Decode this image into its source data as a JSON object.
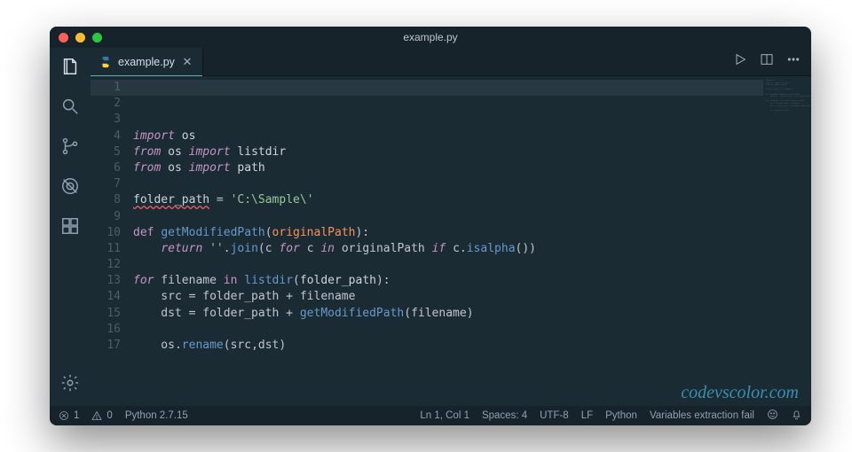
{
  "window": {
    "title": "example.py"
  },
  "tabs": {
    "items": [
      {
        "label": "example.py",
        "icon": "python"
      }
    ]
  },
  "editor": {
    "line_numbers": [
      "1",
      "2",
      "3",
      "4",
      "5",
      "6",
      "7",
      "8",
      "9",
      "10",
      "11",
      "12",
      "13",
      "14",
      "15",
      "16",
      "17"
    ],
    "code_tokens": [
      [
        [
          "kw",
          "import"
        ],
        [
          "pun",
          " "
        ],
        [
          "id",
          "os"
        ]
      ],
      [
        [
          "kw",
          "from"
        ],
        [
          "pun",
          " "
        ],
        [
          "id",
          "os"
        ],
        [
          "pun",
          " "
        ],
        [
          "kw",
          "import"
        ],
        [
          "pun",
          " "
        ],
        [
          "id",
          "listdir"
        ]
      ],
      [
        [
          "kw",
          "from"
        ],
        [
          "pun",
          " "
        ],
        [
          "id",
          "os"
        ],
        [
          "pun",
          " "
        ],
        [
          "kw",
          "import"
        ],
        [
          "pun",
          " "
        ],
        [
          "id",
          "path"
        ]
      ],
      [],
      [
        [
          "id sqr",
          "folder_path"
        ],
        [
          "pun",
          " = "
        ],
        [
          "str",
          "'C:\\Sample\\'"
        ]
      ],
      [],
      [
        [
          "kwni",
          "def"
        ],
        [
          "pun",
          " "
        ],
        [
          "fn",
          "getModifiedPath"
        ],
        [
          "pun",
          "("
        ],
        [
          "par",
          "originalPath"
        ],
        [
          "pun",
          "):"
        ]
      ],
      [
        [
          "pun",
          "    "
        ],
        [
          "kw",
          "return"
        ],
        [
          "pun",
          " "
        ],
        [
          "str",
          "''"
        ],
        [
          "pun",
          "."
        ],
        [
          "fn",
          "join"
        ],
        [
          "pun",
          "(c "
        ],
        [
          "kw",
          "for"
        ],
        [
          "pun",
          " c "
        ],
        [
          "kw",
          "in"
        ],
        [
          "pun",
          " originalPath "
        ],
        [
          "kw",
          "if"
        ],
        [
          "pun",
          " c."
        ],
        [
          "fn",
          "isalpha"
        ],
        [
          "pun",
          "())"
        ]
      ],
      [],
      [
        [
          "kw",
          "for"
        ],
        [
          "pun",
          " filename "
        ],
        [
          "kwni",
          "in"
        ],
        [
          "pun",
          " "
        ],
        [
          "fn",
          "listdir"
        ],
        [
          "pun",
          "("
        ],
        [
          "id",
          "folder_path"
        ],
        [
          "pun",
          "):"
        ]
      ],
      [
        [
          "pun",
          "    src = folder_path + filename"
        ]
      ],
      [
        [
          "pun",
          "    dst = folder_path + "
        ],
        [
          "fn",
          "getModifiedPath"
        ],
        [
          "pun",
          "(filename)"
        ]
      ],
      [],
      [
        [
          "pun",
          "    os."
        ],
        [
          "fn",
          "rename"
        ],
        [
          "pun",
          "(src,dst)"
        ]
      ],
      [],
      [],
      []
    ]
  },
  "status": {
    "errors": "1",
    "warnings": "0",
    "interpreter": "Python 2.7.15",
    "cursor": "Ln 1, Col 1",
    "spaces": "Spaces: 4",
    "encoding": "UTF-8",
    "eol": "LF",
    "language": "Python",
    "extra": "Variables extraction fail"
  },
  "watermark": "codevscolor.com"
}
